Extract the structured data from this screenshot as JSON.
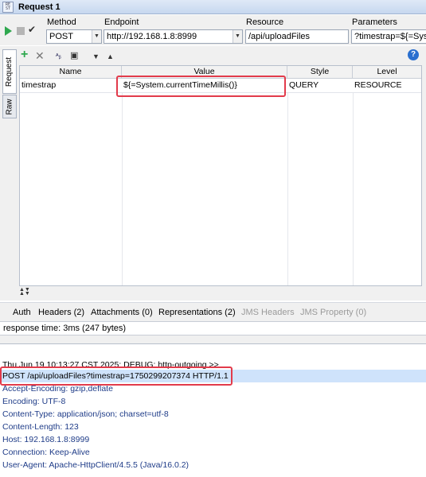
{
  "window": {
    "title": "Request 1",
    "badge": "RE ST"
  },
  "toolbar": {
    "method_label": "Method",
    "method_value": "POST",
    "endpoint_label": "Endpoint",
    "endpoint_value": "http://192.168.1.8:8999",
    "resource_label": "Resource",
    "resource_value": "/api/uploadFiles",
    "parameters_label": "Parameters",
    "parameters_value": "?timestrap=${=Syst"
  },
  "vertical_tabs": [
    "Request",
    "Raw"
  ],
  "params_table": {
    "columns": [
      "Name",
      "Value",
      "Style",
      "Level"
    ],
    "rows": [
      {
        "name": "timestrap",
        "value": "${=System.currentTimeMillis()}",
        "style": "QUERY",
        "level": "RESOURCE"
      }
    ]
  },
  "bottom_tabs": [
    {
      "label": "Auth",
      "enabled": true
    },
    {
      "label": "Headers (2)",
      "enabled": true
    },
    {
      "label": "Attachments (0)",
      "enabled": true
    },
    {
      "label": "Representations (2)",
      "enabled": true
    },
    {
      "label": "JMS Headers",
      "enabled": false
    },
    {
      "label": "JMS Property (0)",
      "enabled": false
    }
  ],
  "status": {
    "response_time": "response time: 3ms (247 bytes)"
  },
  "log": {
    "lines": [
      "Thu Jun 19 10:13:27 CST 2025: DEBUG: http-outgoing >>",
      "POST /api/uploadFiles?timestrap=1750299207374 HTTP/1.1",
      "Accept-Encoding: gzip,deflate",
      "Encoding: UTF-8",
      "Content-Type:  application/json; charset=utf-8",
      "Content-Length: 123",
      "Host: 192.168.1.8:8999",
      "Connection: Keep-Alive",
      "User-Agent: Apache-HttpClient/4.5.5 (Java/16.0.2)"
    ]
  },
  "icons": {
    "run": "play-icon",
    "stop": "stop-icon",
    "check": "check-icon",
    "add": "plus-icon",
    "remove": "x-icon",
    "help": "help-icon"
  },
  "colors": {
    "highlight": "#e23b4b",
    "run": "#2fa84f",
    "log_text": "#1f3c88",
    "selection": "#cfe3fb"
  }
}
